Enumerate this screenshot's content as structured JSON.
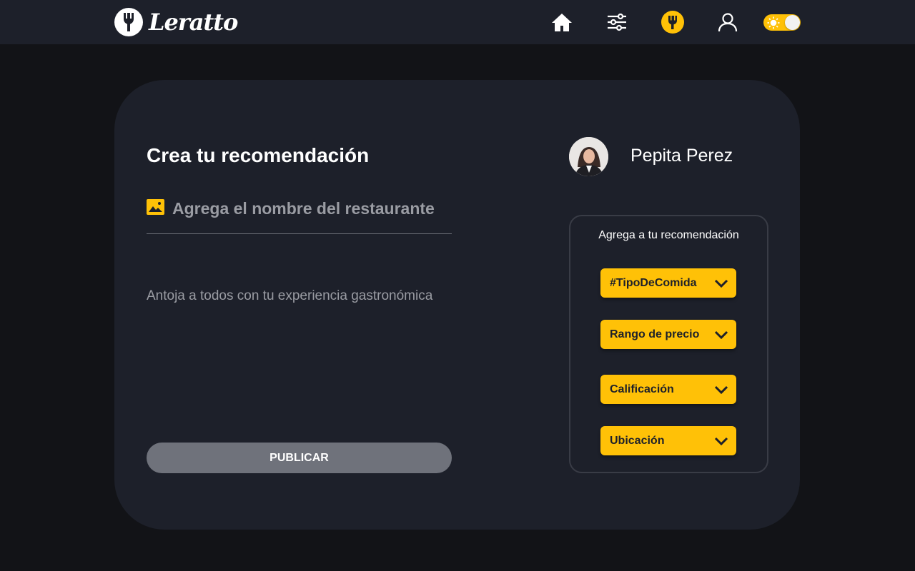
{
  "brand": {
    "name": "Leratto"
  },
  "nav": {
    "home_icon": "home-icon",
    "filters_icon": "sliders-icon",
    "recommend_icon": "fork-icon",
    "profile_icon": "user-icon",
    "theme_toggle": "light-mode"
  },
  "form": {
    "title": "Crea tu recomendación",
    "restaurant_placeholder": "Agrega el nombre del restaurante",
    "description_placeholder": "Antoja a todos con tu experiencia gastronómica",
    "publish_label": "PUBLICAR"
  },
  "profile": {
    "name": "Pepita Perez"
  },
  "tags": {
    "title": "Agrega a tu recomendación",
    "items": [
      {
        "label": "#TipoDeComida"
      },
      {
        "label": "Rango de precio"
      },
      {
        "label": "Calificación"
      },
      {
        "label": "Ubicación"
      }
    ]
  },
  "colors": {
    "accent": "#ffc107",
    "card": "#1d202a",
    "background": "#121317"
  }
}
